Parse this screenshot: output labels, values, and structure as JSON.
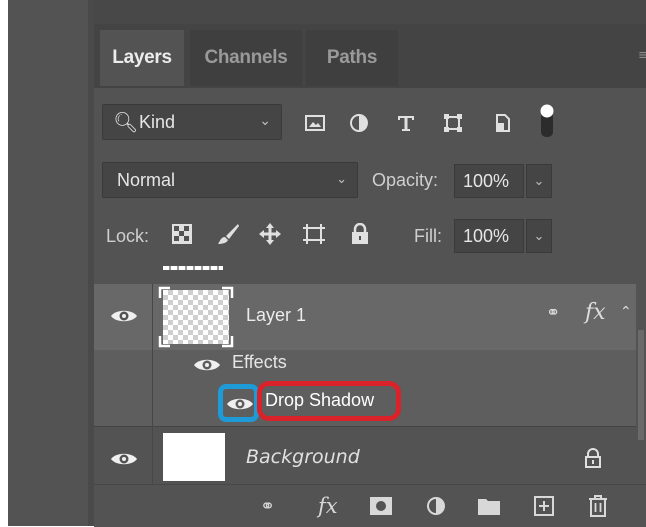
{
  "tabs": [
    {
      "label": "Layers",
      "active": true
    },
    {
      "label": "Channels",
      "active": false
    },
    {
      "label": "Paths",
      "active": false
    }
  ],
  "panel_menu_glyph": "≡",
  "filter": {
    "kind_label": "Kind",
    "icons": [
      "search-icon",
      "image-filter-icon",
      "adjustment-filter-icon",
      "type-filter-icon",
      "shape-filter-icon",
      "smart-object-filter-icon",
      "filter-toggle"
    ]
  },
  "blend": {
    "mode": "Normal",
    "opacity_label": "Opacity:",
    "opacity_value": "100%"
  },
  "lock": {
    "label": "Lock:",
    "fill_label": "Fill:",
    "fill_value": "100%"
  },
  "layers": [
    {
      "name": "Layer 1",
      "visible": true,
      "has_effects": true,
      "effects_label": "Effects",
      "effects": [
        {
          "name": "Drop Shadow",
          "visible": true
        }
      ]
    },
    {
      "name": "Background",
      "visible": true,
      "locked": true
    }
  ],
  "annotations": {
    "red_box_color": "#d9222a",
    "blue_box_color": "#1e9ad6"
  },
  "bottom_toolbar": [
    "link-layers-icon",
    "add-style-icon",
    "add-mask-icon",
    "new-adjustment-icon",
    "new-group-icon",
    "new-layer-icon",
    "delete-layer-icon"
  ]
}
